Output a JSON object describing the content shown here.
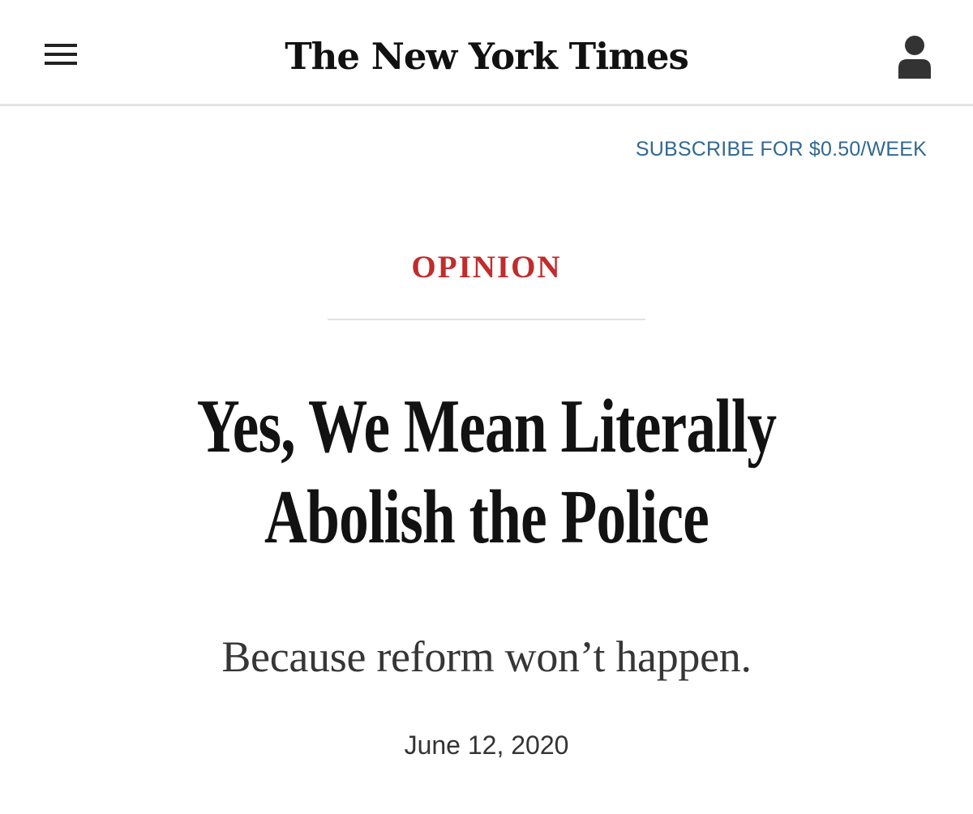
{
  "header": {
    "masthead": "The New York Times",
    "menu_icon": "hamburger-menu-icon",
    "account_icon": "user-account-icon"
  },
  "subscribe": {
    "label": "SUBSCRIBE FOR $0.50/WEEK"
  },
  "article": {
    "section": "OPINION",
    "headline": "Yes, We Mean Literally Abolish the Police",
    "dek": "Because reform won’t happen.",
    "date": "June 12, 2020"
  },
  "colors": {
    "section_red": "#c12c2c",
    "link_blue": "#326891",
    "text_dark": "#121212",
    "header_rule": "#e4e4e4"
  }
}
